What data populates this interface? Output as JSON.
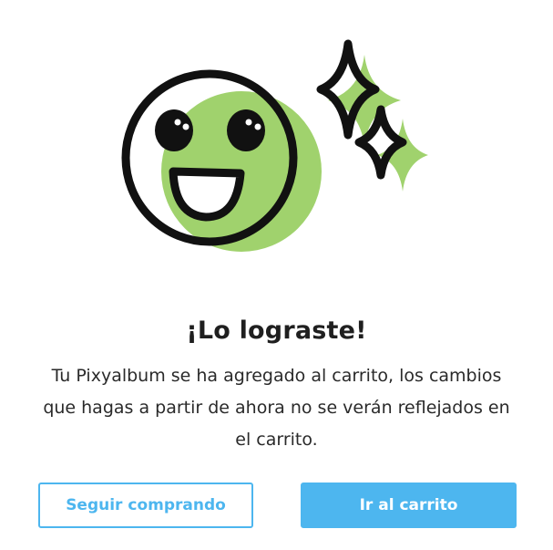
{
  "dialog": {
    "title": "¡Lo lograste!",
    "message": "Tu Pixyalbum se ha agregado al carrito, los cambios que hagas a partir de ahora no se verán reflejados en el carrito.",
    "illustration": "happy-face-with-sparkles-icon"
  },
  "actions": {
    "continue_label": "Seguir comprando",
    "cart_label": "Ir al carrito"
  },
  "colors": {
    "accent_green": "#a0d26d",
    "primary_blue": "#4db6ef",
    "outline": "#111111",
    "text": "#1f1f1f"
  }
}
